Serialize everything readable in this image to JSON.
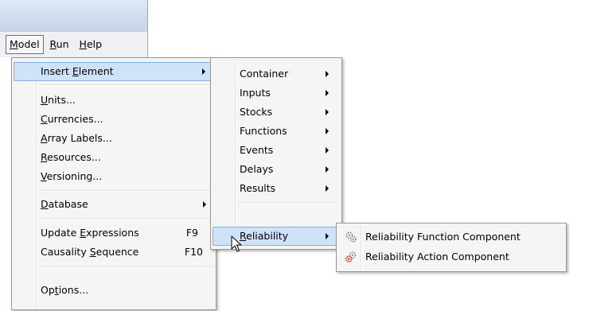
{
  "menubar": {
    "model": {
      "pre": "",
      "key": "M",
      "post": "odel"
    },
    "run": {
      "pre": "",
      "key": "R",
      "post": "un"
    },
    "help": {
      "pre": "",
      "key": "H",
      "post": "elp"
    }
  },
  "model_menu": {
    "insert_element": {
      "pre": "Insert ",
      "key": "E",
      "post": "lement"
    },
    "units": {
      "pre": "",
      "key": "U",
      "post": "nits..."
    },
    "currencies": {
      "pre": "",
      "key": "C",
      "post": "urrencies..."
    },
    "array_labels": {
      "pre": "",
      "key": "A",
      "post": "rray Labels..."
    },
    "resources": {
      "pre": "",
      "key": "R",
      "post": "esources..."
    },
    "versioning": {
      "pre": "",
      "key": "V",
      "post": "ersioning..."
    },
    "database": {
      "pre": "",
      "key": "D",
      "post": "atabase"
    },
    "update_expressions": {
      "pre": "Update ",
      "key": "E",
      "post": "xpressions",
      "shortcut": "F9"
    },
    "causality_sequence": {
      "pre": "Causality ",
      "key": "S",
      "post": "equence",
      "shortcut": "F10"
    },
    "options": {
      "pre": "Op",
      "key": "t",
      "post": "ions..."
    }
  },
  "insert_submenu": {
    "items": [
      "Container",
      "Inputs",
      "Stocks",
      "Functions",
      "Events",
      "Delays",
      "Results"
    ],
    "reliability": {
      "pre": "",
      "key": "R",
      "post": "eliability"
    }
  },
  "reliability_submenu": {
    "function_component": "Reliability Function Component",
    "action_component": "Reliability Action Component"
  },
  "colors": {
    "highlight_bg": "#cfe2fa",
    "highlight_border": "#84acdd",
    "menu_bg": "#f5f5f5"
  },
  "icons": {
    "function_component": "gears-icon",
    "action_component": "gears-red-icon",
    "cursor": "arrow-cursor-icon"
  }
}
